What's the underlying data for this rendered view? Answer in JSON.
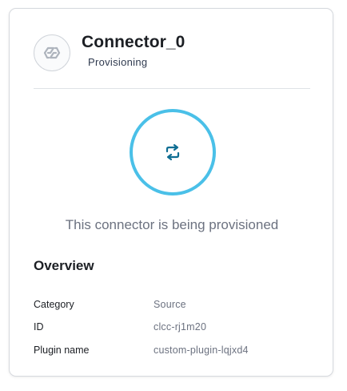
{
  "connector": {
    "name": "Connector_0",
    "status": "Provisioning"
  },
  "icons": {
    "logo": "chain-link-icon",
    "provisioning": "repeat-arrows-icon"
  },
  "colors": {
    "ring": "#4ac0e8",
    "provisioning_icon": "#0f6e93"
  },
  "message": "This connector is being provisioned",
  "overview": {
    "title": "Overview",
    "rows": [
      {
        "label": "Category",
        "value": "Source"
      },
      {
        "label": "ID",
        "value": "clcc-rj1m20"
      },
      {
        "label": "Plugin name",
        "value": "custom-plugin-lqjxd4"
      }
    ]
  }
}
